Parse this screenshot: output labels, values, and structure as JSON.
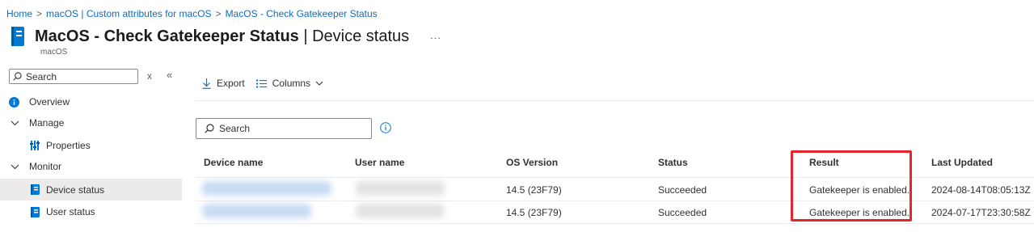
{
  "breadcrumb": {
    "items": [
      "Home",
      "macOS | Custom attributes for macOS",
      "MacOS - Check Gatekeeper Status"
    ],
    "separator": ">"
  },
  "header": {
    "title": "MacOS - Check Gatekeeper Status",
    "title_separator": " | ",
    "page": "Device status",
    "subtitle": "macOS",
    "more": "..."
  },
  "sidebar": {
    "search_placeholder": "Search",
    "clear_symbol": "x",
    "collapse_symbol": "«",
    "items": [
      {
        "label": "Overview",
        "icon": "info-icon"
      },
      {
        "label": "Manage",
        "icon": "chevron-down-icon"
      },
      {
        "label": "Properties",
        "icon": "properties-icon"
      },
      {
        "label": "Monitor",
        "icon": "chevron-down-icon"
      },
      {
        "label": "Device status",
        "icon": "report-icon",
        "selected": true
      },
      {
        "label": "User status",
        "icon": "report-icon"
      }
    ]
  },
  "toolbar": {
    "export_label": "Export",
    "columns_label": "Columns"
  },
  "search": {
    "placeholder": "Search"
  },
  "table": {
    "columns": [
      "Device name",
      "User name",
      "OS Version",
      "Status",
      "Result",
      "Last Updated"
    ],
    "rows": [
      {
        "device": "",
        "user": "",
        "os": "14.5 (23F79)",
        "status": "Succeeded",
        "result": "Gatekeeper is enabled.",
        "updated": "2024-08-14T08:05:13Z"
      },
      {
        "device": "",
        "user": "",
        "os": "14.5 (23F79)",
        "status": "Succeeded",
        "result": "Gatekeeper is enabled.",
        "updated": "2024-07-17T23:30:58Z"
      }
    ]
  },
  "colors": {
    "link": "#0f6cbd",
    "accent": "#0078d4",
    "highlight": "#e5242b",
    "selected_bg": "#edebe9"
  }
}
